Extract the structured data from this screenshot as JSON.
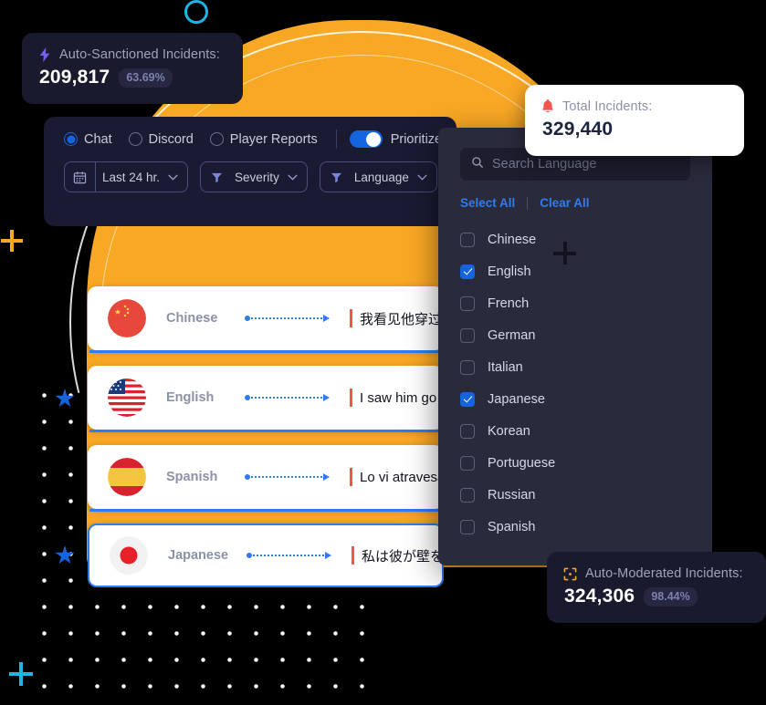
{
  "cards": {
    "sanctioned": {
      "icon": "bolt-icon",
      "label": "Auto-Sanctioned Incidents:",
      "value": "209,817",
      "percent": "63.69%"
    },
    "total": {
      "icon": "bell-icon",
      "label": "Total Incidents:",
      "value": "329,440"
    },
    "moderated": {
      "icon": "scan-icon",
      "label": "Auto-Moderated Incidents:",
      "value": "324,306",
      "percent": "98.44%"
    }
  },
  "filters": {
    "sources": [
      {
        "label": "Chat",
        "selected": true
      },
      {
        "label": "Discord",
        "selected": false
      },
      {
        "label": "Player Reports",
        "selected": false
      }
    ],
    "toggle": {
      "label": "Prioritized",
      "on": true
    },
    "pills": [
      {
        "icon": "calendar-icon",
        "label": "Last 24 hr.",
        "style": "segmented"
      },
      {
        "icon": "funnel-icon",
        "label": "Severity",
        "style": "inline"
      },
      {
        "icon": "funnel-icon",
        "label": "Language",
        "style": "inline"
      }
    ]
  },
  "dropdown": {
    "search": {
      "placeholder": "Search Language",
      "value": "",
      "icon": "search-icon"
    },
    "select_all": "Select All",
    "clear_all": "Clear All",
    "languages": [
      {
        "name": "Chinese",
        "checked": false
      },
      {
        "name": "English",
        "checked": true
      },
      {
        "name": "French",
        "checked": false
      },
      {
        "name": "German",
        "checked": false
      },
      {
        "name": "Italian",
        "checked": false
      },
      {
        "name": "Japanese",
        "checked": true
      },
      {
        "name": "Korean",
        "checked": false
      },
      {
        "name": "Portuguese",
        "checked": false
      },
      {
        "name": "Russian",
        "checked": false
      },
      {
        "name": "Spanish",
        "checked": false
      }
    ]
  },
  "rows": [
    {
      "language": "Chinese",
      "flag": "flag-china",
      "text": "我看见他穿过一堵墙"
    },
    {
      "language": "English",
      "flag": "flag-usa",
      "text": "I saw him go through a wall"
    },
    {
      "language": "Spanish",
      "flag": "flag-spain",
      "text": "Lo vi atravesar una pared"
    },
    {
      "language": "Japanese",
      "flag": "flag-japan",
      "text": "私は彼が壁を通り抜けるのを見た"
    }
  ],
  "colors": {
    "accent_blue": "#1464e0",
    "accent_orange": "#f9a825",
    "accent_cyan": "#19b6e8",
    "alert_red": "#f2554a",
    "panel_dark": "#1a1a33",
    "dropdown_bg": "#2a2a3d"
  }
}
